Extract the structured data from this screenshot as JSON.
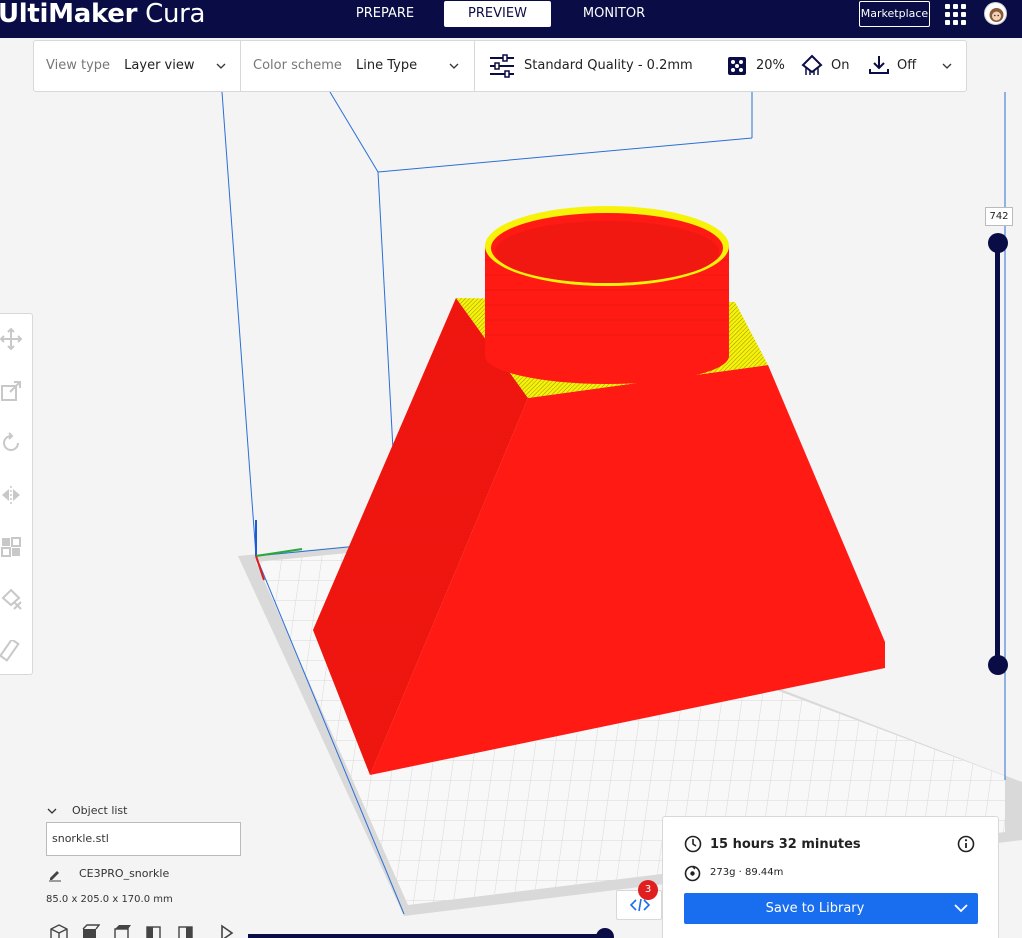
{
  "app": {
    "logo_bold": "UltiMaker",
    "logo_light": "Cura"
  },
  "header": {
    "tabs": [
      {
        "label": "PREPARE",
        "active": false
      },
      {
        "label": "PREVIEW",
        "active": true
      },
      {
        "label": "MONITOR",
        "active": false
      }
    ],
    "marketplace_label": "Marketplace",
    "apps_icon": "grid-icon",
    "avatar_icon": "user-avatar"
  },
  "toolbar": {
    "view_type_label": "View type",
    "view_type_value": "Layer view",
    "color_scheme_label": "Color scheme",
    "color_scheme_value": "Line Type",
    "quality_label": "Standard Quality - 0.2mm",
    "infill_value": "20%",
    "support_value": "On",
    "adhesion_value": "Off"
  },
  "layer_slider": {
    "current_layer": "742"
  },
  "object_list": {
    "title": "Object list",
    "file": "snorkle.stl",
    "project_name": "CE3PRO_snorkle",
    "dimensions": "85.0 x 205.0 x 170.0 mm"
  },
  "print_info": {
    "time": "15 hours 32 minutes",
    "material": "273g · 89.44m",
    "save_label": "Save to Library"
  },
  "gcode": {
    "badge_count": "3"
  },
  "colors": {
    "header_bg": "#0a0d45",
    "accent_blue": "#196ef0",
    "wall_red": "#ff1a14",
    "skin_yellow": "#f7f20a",
    "badge_red": "#e02020"
  }
}
